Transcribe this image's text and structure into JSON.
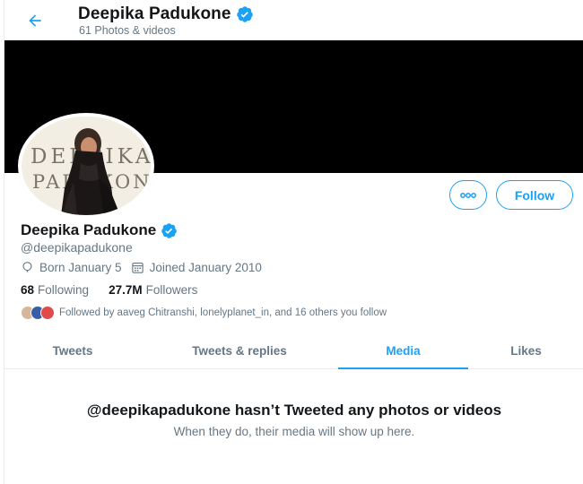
{
  "header": {
    "title": "Deepika Padukone",
    "subtitle": "61 Photos & videos",
    "back_icon": "arrow-left-icon",
    "verified_icon": "verified-badge-icon"
  },
  "banner": {
    "color": "#000000"
  },
  "avatar": {
    "logo_text_line1": "DEEPIKA",
    "logo_text_line2": "PADUKONE"
  },
  "actions": {
    "more_icon": "more-horizontal-icon",
    "follow_label": "Follow"
  },
  "profile": {
    "name": "Deepika Padukone",
    "handle": "@deepikapadukone",
    "born": "Born January 5",
    "joined": "Joined January 2010",
    "following_count": "68",
    "following_label": "Following",
    "followers_count": "27.7M",
    "followers_label": "Followers",
    "followed_by": "Followed by aaveg Chitranshi, lonelyplanet_in, and 16 others you follow"
  },
  "tabs": [
    {
      "label": "Tweets",
      "active": false
    },
    {
      "label": "Tweets & replies",
      "active": false
    },
    {
      "label": "Media",
      "active": true
    },
    {
      "label": "Likes",
      "active": false
    }
  ],
  "empty_state": {
    "title": "@deepikapadukone hasn’t Tweeted any photos or videos",
    "subtitle": "When they do, their media will show up here."
  },
  "colors": {
    "accent": "#1da1f2",
    "secondary_text": "#657786",
    "primary_text": "#14171a"
  }
}
